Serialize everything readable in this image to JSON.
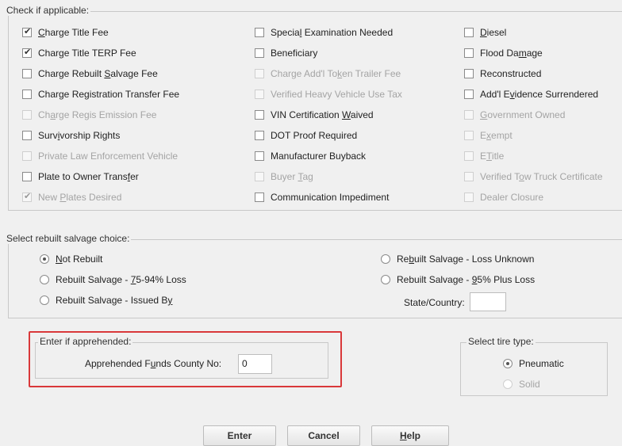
{
  "applicable": {
    "legend": "Check if applicable:",
    "col1": [
      {
        "pre": "",
        "u": "C",
        "post": "harge Title Fee",
        "checked": true,
        "disabled": false
      },
      {
        "pre": "Char",
        "u": "g",
        "post": "e Title TERP Fee",
        "checked": true,
        "disabled": false
      },
      {
        "pre": "Charge Rebuilt ",
        "u": "S",
        "post": "alvage Fee",
        "checked": false,
        "disabled": false
      },
      {
        "pre": "Charge Registration Transfer Fee",
        "u": "",
        "post": "",
        "checked": false,
        "disabled": false
      },
      {
        "pre": "Ch",
        "u": "a",
        "post": "rge Regis Emission Fee",
        "checked": false,
        "disabled": true
      },
      {
        "pre": "Surv",
        "u": "i",
        "post": "vorship Rights",
        "checked": false,
        "disabled": false
      },
      {
        "pre": "Private Law Enforcement Vehicle",
        "u": "",
        "post": "",
        "checked": false,
        "disabled": true
      },
      {
        "pre": "Plate to Owner Trans",
        "u": "f",
        "post": "er",
        "checked": false,
        "disabled": false
      },
      {
        "pre": "New ",
        "u": "P",
        "post": "lates Desired",
        "checked": true,
        "disabled": true
      }
    ],
    "col2": [
      {
        "pre": "Specia",
        "u": "l",
        "post": " Examination Needed",
        "checked": false,
        "disabled": false
      },
      {
        "pre": "Beneficiary",
        "u": "",
        "post": "",
        "checked": false,
        "disabled": false
      },
      {
        "pre": "Charge Add'l To",
        "u": "k",
        "post": "en Trailer Fee",
        "checked": false,
        "disabled": true
      },
      {
        "pre": "Verified Heavy Vehicle Use Tax",
        "u": "",
        "post": "",
        "checked": false,
        "disabled": true
      },
      {
        "pre": "VIN Certification ",
        "u": "W",
        "post": "aived",
        "checked": false,
        "disabled": false
      },
      {
        "pre": "DOT Proof Required",
        "u": "",
        "post": "",
        "checked": false,
        "disabled": false
      },
      {
        "pre": "Manufacturer Buyback",
        "u": "",
        "post": "",
        "checked": false,
        "disabled": false
      },
      {
        "pre": "Buyer ",
        "u": "T",
        "post": "ag",
        "checked": false,
        "disabled": true
      },
      {
        "pre": "Communication Impediment",
        "u": "",
        "post": "",
        "checked": false,
        "disabled": false
      }
    ],
    "col3": [
      {
        "pre": "",
        "u": "D",
        "post": "iesel",
        "checked": false,
        "disabled": false
      },
      {
        "pre": "Flood Da",
        "u": "m",
        "post": "age",
        "checked": false,
        "disabled": false
      },
      {
        "pre": "Reconstructed",
        "u": "",
        "post": "",
        "checked": false,
        "disabled": false
      },
      {
        "pre": "Add'l E",
        "u": "v",
        "post": "idence Surrendered",
        "checked": false,
        "disabled": false
      },
      {
        "pre": "",
        "u": "G",
        "post": "overnment Owned",
        "checked": false,
        "disabled": true
      },
      {
        "pre": "E",
        "u": "x",
        "post": "empt",
        "checked": false,
        "disabled": true
      },
      {
        "pre": "E",
        "u": "T",
        "post": "itle",
        "checked": false,
        "disabled": true
      },
      {
        "pre": "Verified T",
        "u": "o",
        "post": "w Truck Certificate",
        "checked": false,
        "disabled": true
      },
      {
        "pre": "Dealer Closure",
        "u": "",
        "post": "",
        "checked": false,
        "disabled": true
      }
    ]
  },
  "salvage": {
    "legend": "Select rebuilt salvage choice:",
    "left": [
      {
        "pre": "",
        "u": "N",
        "post": "ot Rebuilt",
        "checked": true,
        "disabled": false
      },
      {
        "pre": "Rebuilt Salvage - ",
        "u": "7",
        "post": "5-94% Loss",
        "checked": false,
        "disabled": false
      },
      {
        "pre": "Rebuilt Salvage - Issued B",
        "u": "y",
        "post": "",
        "checked": false,
        "disabled": false
      }
    ],
    "right": [
      {
        "pre": "Re",
        "u": "b",
        "post": "uilt Salvage - Loss Unknown",
        "checked": false,
        "disabled": false
      },
      {
        "pre": "Rebuilt Salvage - ",
        "u": "9",
        "post": "5% Plus Loss",
        "checked": false,
        "disabled": false
      }
    ],
    "state_label": "State/Country:",
    "state_value": ""
  },
  "apprehended": {
    "legend": "Enter if apprehended:",
    "label_pre": "Apprehended F",
    "label_u": "u",
    "label_post": "nds County No:",
    "value": "0",
    "highlight_color": "#d9383a"
  },
  "tire": {
    "legend": "Select tire type:",
    "options": [
      {
        "label": "Pneumatic",
        "checked": true,
        "disabled": false
      },
      {
        "label": "Solid",
        "checked": false,
        "disabled": true
      }
    ]
  },
  "buttons": {
    "enter": "Enter",
    "cancel": "Cancel",
    "help_u": "H",
    "help_post": "elp"
  }
}
